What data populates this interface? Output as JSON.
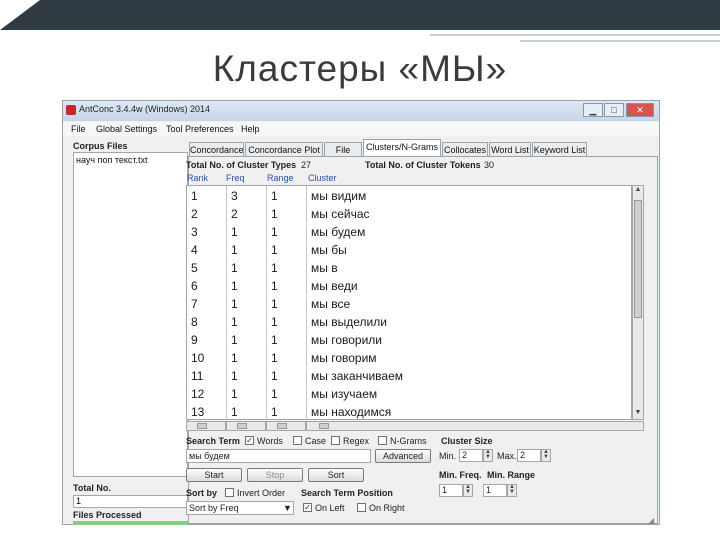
{
  "slide": {
    "title": "Кластеры «МЫ»"
  },
  "window": {
    "title": "AntConc 3.4.4w (Windows) 2014",
    "min_icon": "minimize-icon",
    "max_icon": "maximize-icon",
    "close_icon": "close-icon"
  },
  "menu": [
    "File",
    "Global Settings",
    "Tool Preferences",
    "Help"
  ],
  "corpus": {
    "label": "Corpus Files",
    "files": [
      "науч поп текст.txt"
    ],
    "total_label": "Total No.",
    "total_value": "1",
    "processed_label": "Files Processed"
  },
  "tabs": [
    "Concordance",
    "Concordance Plot",
    "File View",
    "Clusters/N-Grams",
    "Collocates",
    "Word List",
    "Keyword List"
  ],
  "active_tab": "Clusters/N-Grams",
  "stats": {
    "types_label": "Total No. of Cluster Types",
    "types_value": "27",
    "tokens_label": "Total No. of Cluster Tokens",
    "tokens_value": "30"
  },
  "columns": [
    "Rank",
    "Freq",
    "Range",
    "Cluster"
  ],
  "rows": [
    {
      "rank": "1",
      "freq": "3",
      "range": "1",
      "cluster": "мы видим"
    },
    {
      "rank": "2",
      "freq": "2",
      "range": "1",
      "cluster": "мы сейчас"
    },
    {
      "rank": "3",
      "freq": "1",
      "range": "1",
      "cluster": "мы будем"
    },
    {
      "rank": "4",
      "freq": "1",
      "range": "1",
      "cluster": "мы бы"
    },
    {
      "rank": "5",
      "freq": "1",
      "range": "1",
      "cluster": "мы в"
    },
    {
      "rank": "6",
      "freq": "1",
      "range": "1",
      "cluster": "мы веди"
    },
    {
      "rank": "7",
      "freq": "1",
      "range": "1",
      "cluster": "мы все"
    },
    {
      "rank": "8",
      "freq": "1",
      "range": "1",
      "cluster": "мы выделили"
    },
    {
      "rank": "9",
      "freq": "1",
      "range": "1",
      "cluster": "мы говорили"
    },
    {
      "rank": "10",
      "freq": "1",
      "range": "1",
      "cluster": "мы говорим"
    },
    {
      "rank": "11",
      "freq": "1",
      "range": "1",
      "cluster": "мы заканчиваем"
    },
    {
      "rank": "12",
      "freq": "1",
      "range": "1",
      "cluster": "мы изучаем"
    },
    {
      "rank": "13",
      "freq": "1",
      "range": "1",
      "cluster": "мы находимся"
    }
  ],
  "search": {
    "label": "Search Term",
    "words_label": "Words",
    "case_label": "Case",
    "regex_label": "Regex",
    "ngrams_label": "N-Grams",
    "words_checked": true,
    "case_checked": false,
    "regex_checked": false,
    "ngrams_checked": false,
    "query": "мы будем",
    "advanced_label": "Advanced"
  },
  "cluster_size": {
    "label": "Cluster Size",
    "min_label": "Min.",
    "min_value": "2",
    "max_label": "Max.",
    "max_value": "2"
  },
  "buttons": {
    "start": "Start",
    "stop": "Stop",
    "sort": "Sort"
  },
  "min_freq": {
    "label": "Min. Freq.",
    "value": "1"
  },
  "min_range": {
    "label": "Min. Range",
    "value": "1"
  },
  "sort": {
    "label": "Sort by",
    "invert_label": "Invert Order",
    "invert_checked": false,
    "selected": "Sort by Freq"
  },
  "position": {
    "label": "Search Term Position",
    "on_left_label": "On Left",
    "on_right_label": "On Right",
    "on_left_checked": true,
    "on_right_checked": false
  }
}
